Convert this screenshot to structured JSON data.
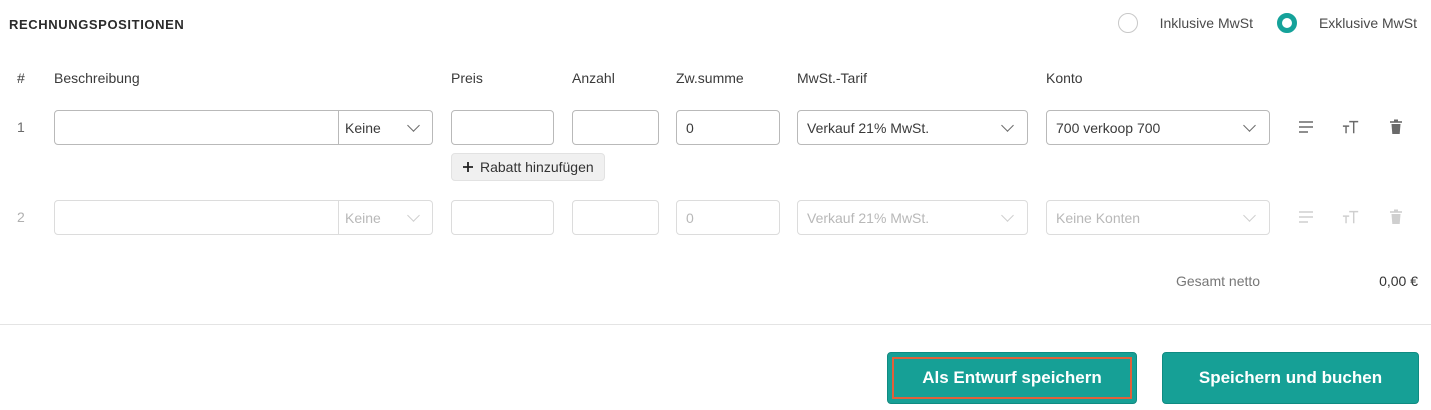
{
  "section": {
    "title": "RECHNUNGSPOSITIONEN",
    "tax_options": [
      {
        "label": "Inklusive MwSt",
        "checked": false
      },
      {
        "label": "Exklusive MwSt",
        "checked": true
      }
    ]
  },
  "columns": {
    "hash": "#",
    "description": "Beschreibung",
    "price": "Preis",
    "quantity": "Anzahl",
    "subtotal": "Zw.summe",
    "vat_rate": "MwSt.-Tarif",
    "account": "Konto"
  },
  "rows": [
    {
      "num": "1",
      "description": "",
      "unit": "Keine",
      "price": "",
      "quantity": "",
      "subtotal": "0",
      "vat_rate": "Verkauf 21% MwSt.",
      "account": "700 verkoop 700"
    },
    {
      "num": "2",
      "description": "",
      "unit": "Keine",
      "price": "",
      "quantity": "",
      "subtotal": "0",
      "vat_rate": "Verkauf 21% MwSt.",
      "account": "Keine Konten"
    }
  ],
  "discount_button": "Rabatt hinzufügen",
  "totals": {
    "label": "Gesamt netto",
    "value": "0,00 €"
  },
  "actions": {
    "draft": "Als Entwurf speichern",
    "save": "Speichern und buchen"
  },
  "colors": {
    "accent": "#16a096",
    "focus_ring": "#e0603a"
  },
  "icons": [
    "align-lines-icon",
    "text-size-icon",
    "trash-icon",
    "plus-icon",
    "chevron-down-icon"
  ]
}
